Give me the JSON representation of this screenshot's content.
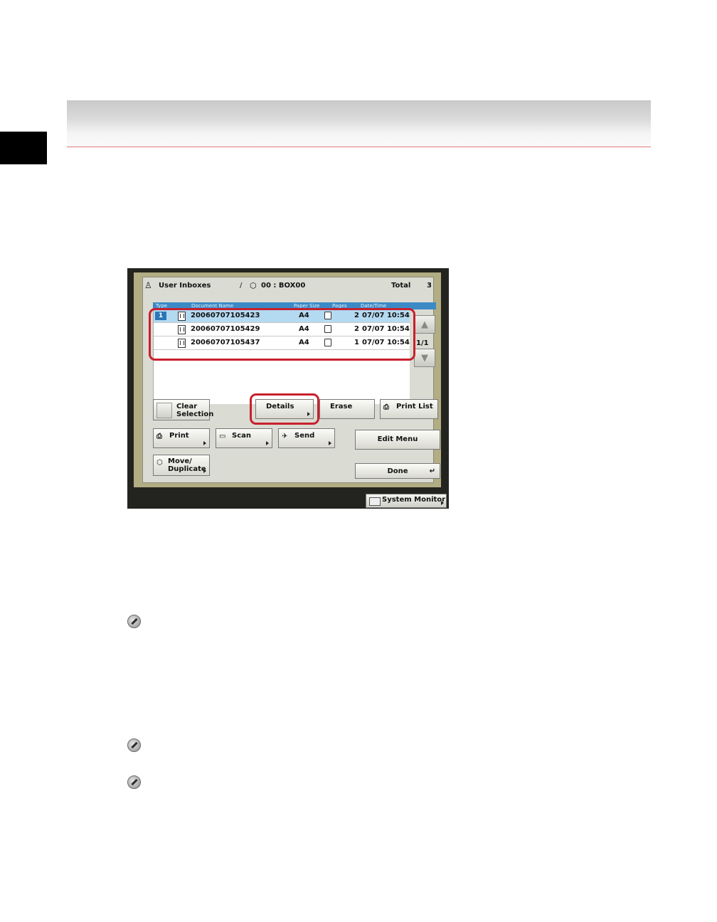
{
  "header": {
    "title": ""
  },
  "screen": {
    "title": "User Inboxes",
    "separator": "/",
    "box_label": "00 : BOX00",
    "total_label": "Total",
    "total_value": "3",
    "columns": [
      "Type",
      "Document Name",
      "Paper Size",
      "Pages",
      "Date/Time"
    ],
    "rows": [
      {
        "num": "1",
        "name": "20060707105423",
        "size": "A4",
        "pages": "2",
        "datetime": "07/07 10:54",
        "selected": true
      },
      {
        "num": "",
        "name": "20060707105429",
        "size": "A4",
        "pages": "2",
        "datetime": "07/07 10:54",
        "selected": false
      },
      {
        "num": "",
        "name": "20060707105437",
        "size": "A4",
        "pages": "1",
        "datetime": "07/07 10:54",
        "selected": false
      }
    ],
    "page_indicator": "1/1",
    "buttons": {
      "clear_selection_1": "Clear",
      "clear_selection_2": "Selection",
      "details": "Details",
      "erase": "Erase",
      "print_list": "Print List",
      "print": "Print",
      "scan": "Scan",
      "send": "Send",
      "edit_menu": "Edit Menu",
      "move_duplicate_1": "Move/",
      "move_duplicate_2": "Duplicate",
      "done": "Done"
    },
    "system_monitor": "System Monitor"
  },
  "colors": {
    "highlight": "#c8202c",
    "selected_row": "#b4daf1",
    "column_bar": "#3b8ac6",
    "panel_border": "#b2ad83"
  },
  "icons": [
    "user-icon",
    "box-icon",
    "document-icon",
    "paper-icon",
    "printer-icon",
    "scanner-icon",
    "send-icon",
    "move-icon",
    "monitor-icon",
    "pencil-note-icon"
  ]
}
